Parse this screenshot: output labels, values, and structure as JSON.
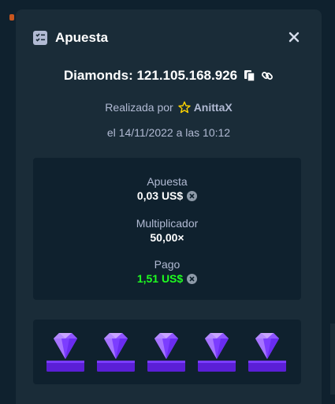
{
  "modal": {
    "title": "Apuesta",
    "title_icon": "list-checks-icon",
    "close_icon": "close-icon"
  },
  "game": {
    "headline": "Diamonds: 121.105.168.926",
    "copy_icon": "copy-icon",
    "link_icon": "link-icon"
  },
  "meta": {
    "placed_by_label": "Realizada por",
    "star_icon": "star-icon",
    "username": "AnittaX",
    "date_text": "el 14/11/2022 a las 10:12"
  },
  "stats": {
    "bet_label": "Apuesta",
    "bet_value": "0,03 US$",
    "multiplier_label": "Multiplicador",
    "multiplier_value": "50,00×",
    "payout_label": "Pago",
    "payout_value": "1,51 US$",
    "currency_icon": "coin-icon"
  },
  "colors": {
    "background": "#0f212e",
    "panel": "#1a2c38",
    "text_muted": "#b1bad3",
    "payout_green": "#1fff20",
    "gem_purple": "#8a4dff"
  },
  "board": {
    "gems": [
      "diamond-icon",
      "diamond-icon",
      "diamond-icon",
      "diamond-icon",
      "diamond-icon"
    ]
  }
}
